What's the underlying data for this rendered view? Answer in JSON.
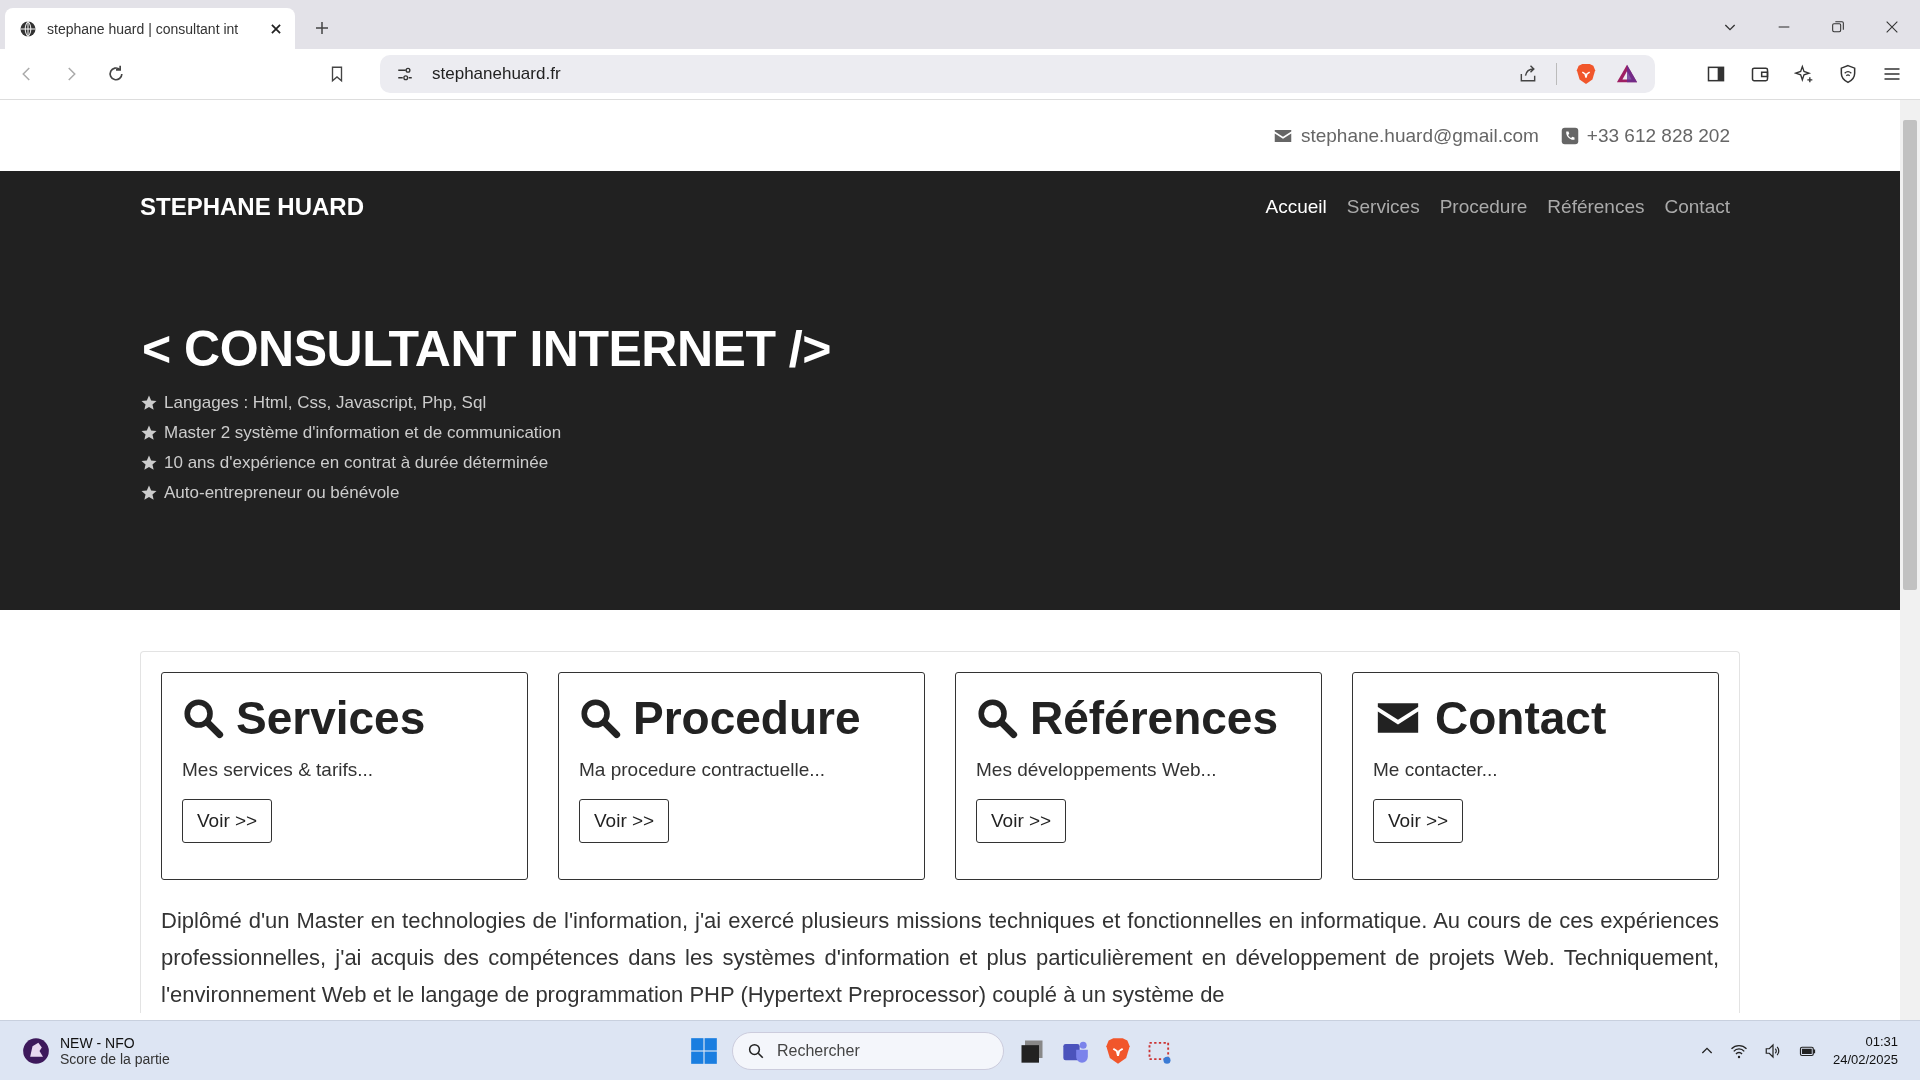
{
  "browser": {
    "tab": {
      "title": "stephane huard | consultant int"
    },
    "url": "stephanehuard.fr"
  },
  "contact_bar": {
    "email": "stephane.huard@gmail.com",
    "phone": "+33 612 828 202"
  },
  "navbar": {
    "brand": "STEPHANE HUARD",
    "items": [
      {
        "label": "Accueil",
        "selected": true
      },
      {
        "label": "Services",
        "selected": false
      },
      {
        "label": "Procedure",
        "selected": false
      },
      {
        "label": "Références",
        "selected": false
      },
      {
        "label": "Contact",
        "selected": false
      }
    ]
  },
  "hero": {
    "title": "< CONSULTANT INTERNET />",
    "bullets": [
      "Langages : Html, Css, Javascript, Php, Sql",
      "Master 2 système d'information et de communication",
      "10 ans d'expérience en contrat à durée déterminée",
      "Auto-entrepreneur ou bénévole"
    ]
  },
  "cards": [
    {
      "kind": "search",
      "title": "Services",
      "text": "Mes services & tarifs...",
      "button": "Voir >>"
    },
    {
      "kind": "search",
      "title": "Procedure",
      "text": "Ma procedure contractuelle...",
      "button": "Voir >>"
    },
    {
      "kind": "search",
      "title": "Références",
      "text": "Mes développements Web...",
      "button": "Voir >>"
    },
    {
      "kind": "mail",
      "title": "Contact",
      "text": "Me contacter...",
      "button": "Voir >>"
    }
  ],
  "intro": "Diplômé d'un Master en technologies de l'information, j'ai exercé plusieurs missions techniques et fonctionnelles en informatique. Au cours de ces expériences professionnelles, j'ai acquis des compétences dans les systèmes d'information et plus particulièrement en développement de projets Web. Techniquement, l'environnement Web et le langage de programmation PHP (Hypertext Preprocessor) couplé à un système de",
  "taskbar": {
    "widget_title": "NEW - NFO",
    "widget_subtitle": "Score de la partie",
    "search_placeholder": "Rechercher",
    "time": "01:31",
    "date": "24/02/2025"
  }
}
